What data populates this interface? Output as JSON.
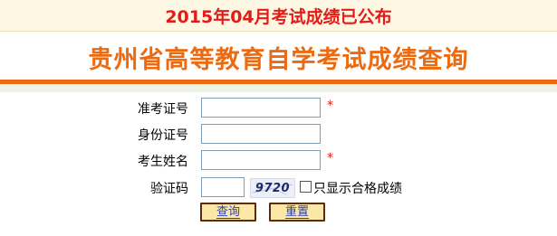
{
  "notice": {
    "text": "2015年04月考试成绩已公布"
  },
  "title": {
    "text": "贵州省高等教育自学考试成绩查询"
  },
  "form": {
    "exam_number": {
      "label": "准考证号",
      "value": "",
      "required_mark": "*"
    },
    "id_number": {
      "label": "身份证号",
      "value": ""
    },
    "name": {
      "label": "考生姓名",
      "value": "",
      "required_mark": "*"
    },
    "captcha": {
      "label": "验证码",
      "value": "",
      "image_text": "9720"
    },
    "pass_only": {
      "label": "只显示合格成绩",
      "checked": false
    }
  },
  "buttons": {
    "query": "查询",
    "reset": "重置"
  },
  "colors": {
    "notice_red": "#e41b17",
    "title_orange": "#ec6a10",
    "button_bg": "#fbe7a8",
    "button_border": "#5a2c10",
    "button_text": "#2c3fb4"
  }
}
